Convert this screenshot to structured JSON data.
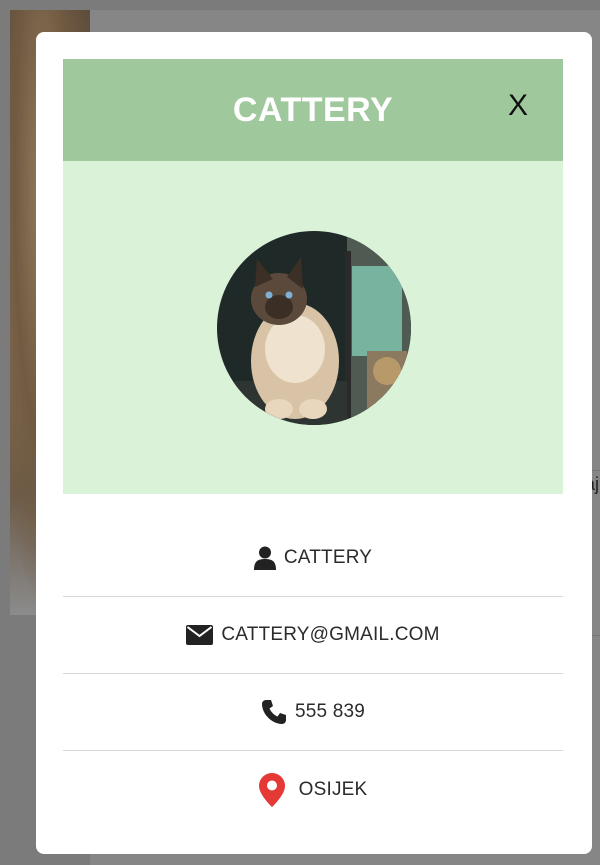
{
  "modal": {
    "title": "CATTERY",
    "close_label": "X"
  },
  "profile": {
    "photo_icon": "cat-photo",
    "rows": [
      {
        "icon": "user-icon",
        "text": "CATTERY"
      },
      {
        "icon": "envelope-icon",
        "text": "CATTERY@GMAIL.COM"
      },
      {
        "icon": "phone-icon",
        "text": "555 839"
      },
      {
        "icon": "location-pin-icon",
        "text": "OSIJEK"
      }
    ]
  },
  "background": {
    "peek_text_1": "aj",
    "peek_text_2": ":"
  },
  "colors": {
    "header_bg": "#9fc99d",
    "photo_bg": "#daf2d8",
    "pin": "#e53935"
  }
}
